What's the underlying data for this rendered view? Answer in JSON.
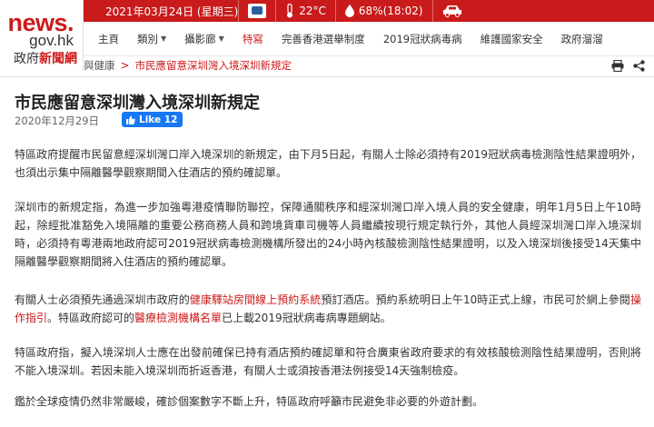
{
  "logo": {
    "line1": "news.",
    "line2": "gov.hk",
    "line3_a": "政府",
    "line3_b": "新聞網"
  },
  "topbar": {
    "date": "2021年03月24日 (星期三)",
    "temperature": "22°C",
    "humidity": "68%(18:02)"
  },
  "nav": {
    "items": [
      "主頁",
      "類別",
      "攝影廊",
      "特寫",
      "完善香港選舉制度",
      "2019冠狀病毒病",
      "維護國家安全",
      "政府溜溜"
    ],
    "active_index": 3
  },
  "breadcrumb": {
    "category": "與健康",
    "separator": ">",
    "current": "市民應留意深圳灣入境深圳新規定"
  },
  "article": {
    "title": "市民應留意深圳灣入境深圳新規定",
    "date": "2020年12月29日",
    "like_label": "Like 12",
    "p1": "特區政府提醒市民留意經深圳灣口岸入境深圳的新規定，由下月5日起，有關人士除必須持有2019冠狀病毒檢測陰性結果證明外，也須出示集中隔離醫學觀察期間入住酒店的預約確認單。",
    "p2": "深圳市的新規定指，為進一步加強粵港疫情聯防聯控，保障通關秩序和經深圳灣口岸入境人員的安全健康，明年1月5日上午10時起，除經批准豁免入境隔離的重要公務商務人員和跨境貨車司機等人員繼續按現行規定執行外，其他人員經深圳灣口岸入境深圳時，必須持有粵港兩地政府認可2019冠狀病毒檢測機構所發出的24小時內核酸檢測陰性結果證明，以及入境深圳後接受14天集中隔離醫學觀察期間將入住酒店的預約確認單。",
    "p3_a": "有關人士必須預先通過深圳市政府的",
    "p3_link1": "健康驛站房間線上預約系統",
    "p3_b": "預訂酒店。預約系統明日上午10時正式上線，市民可於網上參閱",
    "p3_link2": "操作指引",
    "p3_c": "。特區政府認可的",
    "p3_link3": "醫療檢測機構名單",
    "p3_d": "已上載2019冠狀病毒病專題網站。",
    "p4": "特區政府指，擬入境深圳人士應在出發前確保已持有酒店預約確認單和符合廣東省政府要求的有效核酸檢測陰性結果證明，否則將不能入境深圳。若因未能入境深圳而折返香港，有關人士或須按香港法例接受14天強制檢疫。",
    "p5": "鑑於全球疫情仍然非常嚴峻，確診個案數字不斷上升，特區政府呼籲市民避免非必要的外遊計劃。"
  },
  "icons": {
    "weather": "weather-icon",
    "temperature": "thermometer-icon",
    "humidity": "water-drop-icon",
    "traffic": "car-icon",
    "print": "print-icon",
    "share": "share-icon",
    "like": "thumbs-up-icon"
  },
  "colors": {
    "brand_red": "#c91b1b",
    "link_red": "#cc1a1a",
    "facebook_blue": "#1877f2"
  }
}
